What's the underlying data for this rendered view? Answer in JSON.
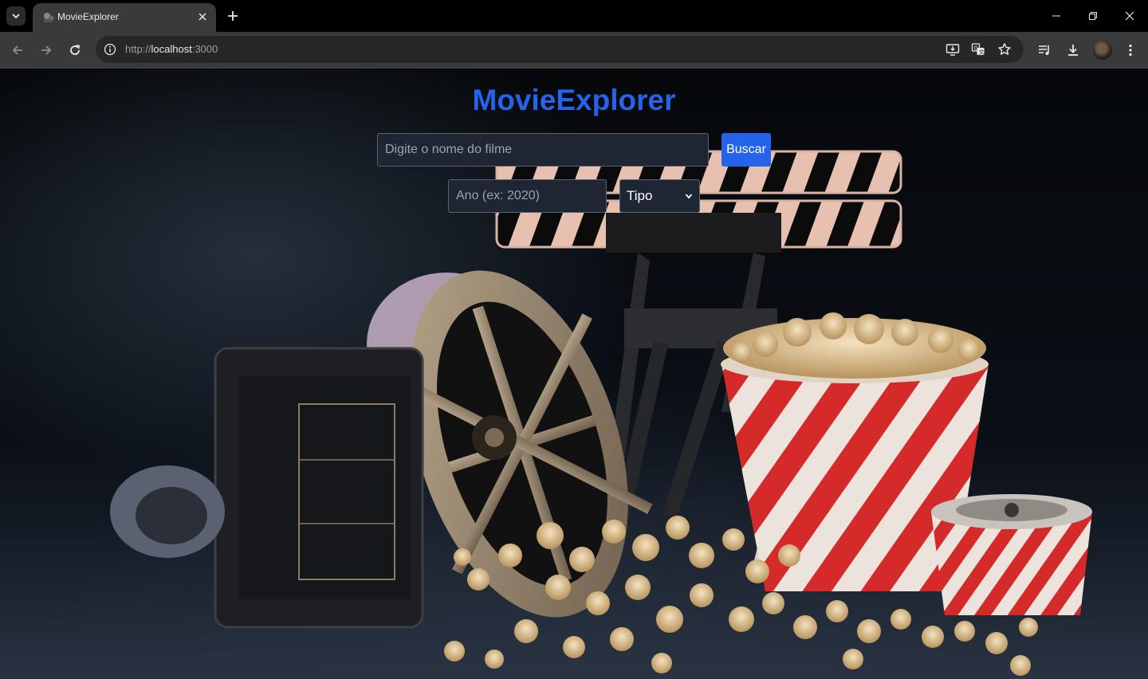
{
  "browser": {
    "tab_title": "MovieExplorer",
    "url_scheme": "http://",
    "url_host": "localhost",
    "url_port": ":3000"
  },
  "app": {
    "title": "MovieExplorer",
    "search": {
      "placeholder": "Digite o nome do filme",
      "value": "",
      "button_label": "Buscar"
    },
    "filters": {
      "year_placeholder": "Ano (ex: 2020)",
      "year_value": "",
      "type_selected": "Tipo"
    },
    "background": {
      "description_icons": [
        "clapperboard",
        "film-reel",
        "popcorn-bucket",
        "film-projector",
        "film-can"
      ]
    }
  },
  "colors": {
    "accent": "#2563eb",
    "chrome_bg": "#3a3a3a",
    "tabstrip_bg": "#000000",
    "input_bg": "#1f2633"
  }
}
